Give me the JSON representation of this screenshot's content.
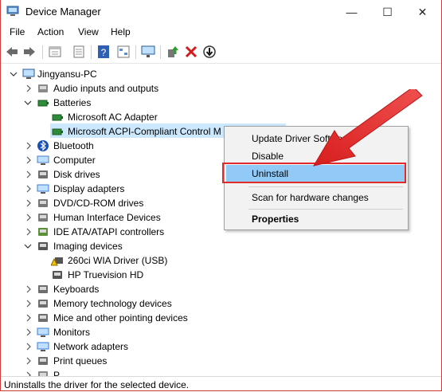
{
  "window": {
    "title": "Device Manager",
    "controls": {
      "minimize": "—",
      "maximize": "☐",
      "close": "✕"
    }
  },
  "menu": [
    "File",
    "Action",
    "View",
    "Help"
  ],
  "toolbar_icons": [
    "back-icon",
    "forward-icon",
    "properties-sheet-icon",
    "show-hidden-icon",
    "help-icon",
    "device-view-icon",
    "scan-monitor-icon",
    "update-driver-icon",
    "uninstall-red-x-icon",
    "disable-device-icon"
  ],
  "tree": {
    "root": "Jingyansu-PC",
    "nodes": [
      {
        "label": "Audio inputs and outputs",
        "icon": "audio-icon",
        "depth": 1,
        "expanded": false
      },
      {
        "label": "Batteries",
        "icon": "battery-icon",
        "depth": 1,
        "expanded": true
      },
      {
        "label": "Microsoft AC Adapter",
        "icon": "battery-device-icon",
        "depth": 2
      },
      {
        "label": "Microsoft ACPI-Compliant Control M",
        "icon": "battery-device-icon",
        "depth": 2,
        "selected": true
      },
      {
        "label": "Bluetooth",
        "icon": "bluetooth-icon",
        "depth": 1,
        "expanded": false
      },
      {
        "label": "Computer",
        "icon": "computer-icon",
        "depth": 1,
        "expanded": false
      },
      {
        "label": "Disk drives",
        "icon": "disk-icon",
        "depth": 1,
        "expanded": false
      },
      {
        "label": "Display adapters",
        "icon": "display-icon",
        "depth": 1,
        "expanded": false
      },
      {
        "label": "DVD/CD-ROM drives",
        "icon": "dvd-icon",
        "depth": 1,
        "expanded": false
      },
      {
        "label": "Human Interface Devices",
        "icon": "hid-icon",
        "depth": 1,
        "expanded": false
      },
      {
        "label": "IDE ATA/ATAPI controllers",
        "icon": "ide-icon",
        "depth": 1,
        "expanded": false
      },
      {
        "label": "Imaging devices",
        "icon": "camera-icon",
        "depth": 1,
        "expanded": true
      },
      {
        "label": "260ci WIA Driver (USB)",
        "icon": "warning-camera-icon",
        "depth": 2
      },
      {
        "label": "HP Truevision HD",
        "icon": "camera-device-icon",
        "depth": 2
      },
      {
        "label": "Keyboards",
        "icon": "keyboard-icon",
        "depth": 1,
        "expanded": false
      },
      {
        "label": "Memory technology devices",
        "icon": "memory-icon",
        "depth": 1,
        "expanded": false
      },
      {
        "label": "Mice and other pointing devices",
        "icon": "mouse-icon",
        "depth": 1,
        "expanded": false
      },
      {
        "label": "Monitors",
        "icon": "monitor-icon",
        "depth": 1,
        "expanded": false
      },
      {
        "label": "Network adapters",
        "icon": "network-icon",
        "depth": 1,
        "expanded": false
      },
      {
        "label": "Print queues",
        "icon": "printer-icon",
        "depth": 1,
        "expanded": false
      },
      {
        "label": "P",
        "icon": "generic-device-icon",
        "depth": 1,
        "expanded": false
      }
    ]
  },
  "context_menu": {
    "items": [
      "Update Driver Software...",
      "Disable",
      "Uninstall",
      "Scan for hardware changes",
      "Properties"
    ],
    "highlighted": "Uninstall"
  },
  "status": "Uninstalls the driver for the selected device.",
  "colors": {
    "selection": "#cce8ff",
    "menu_highlight": "#91c9f7",
    "annotation_red": "#e22a2a",
    "window_border": "#cf3b3b"
  }
}
